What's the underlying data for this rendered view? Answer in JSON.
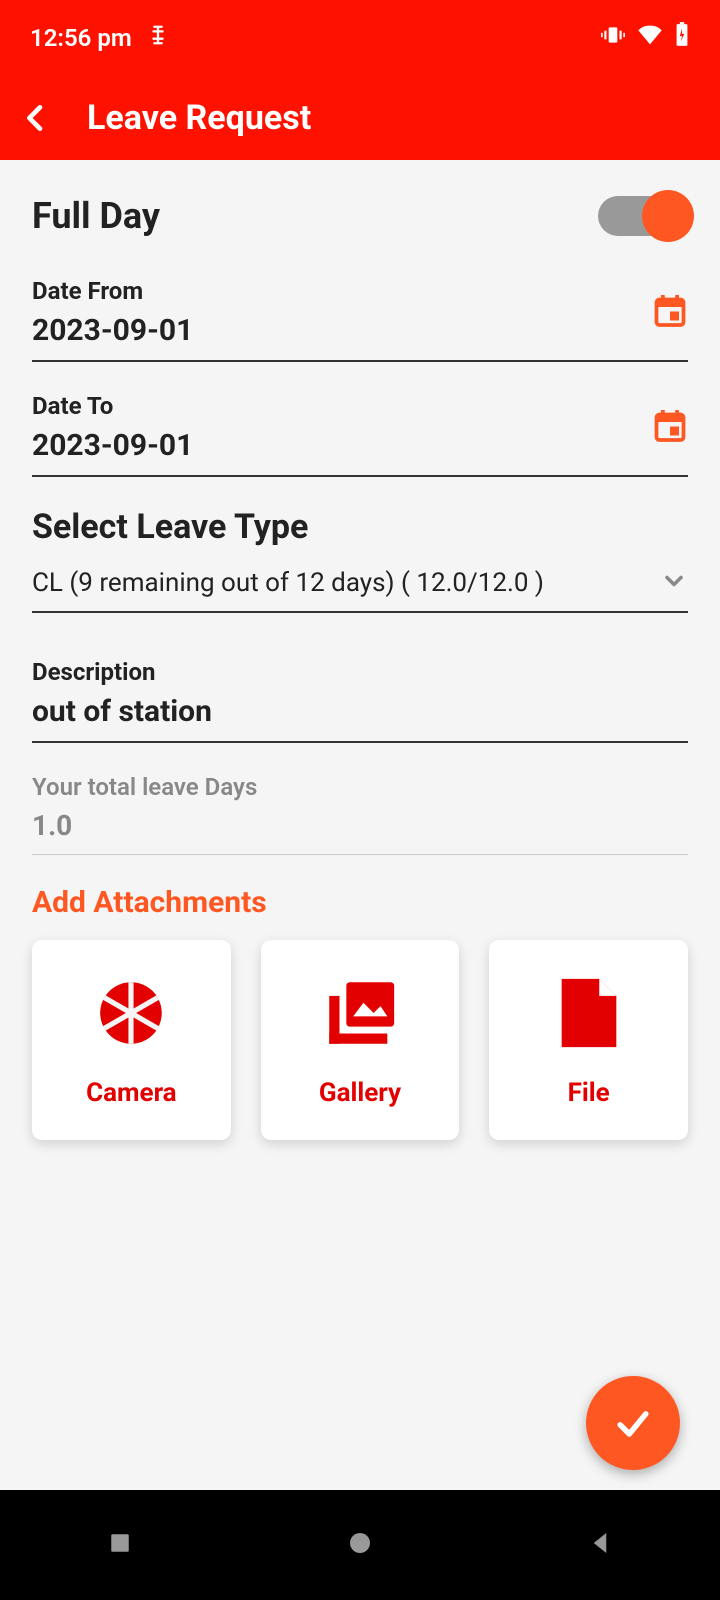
{
  "statusBar": {
    "time": "12:56 pm"
  },
  "appBar": {
    "title": "Leave Request"
  },
  "fullDay": {
    "label": "Full Day",
    "enabled": true
  },
  "dateFrom": {
    "label": "Date From",
    "value": "2023-09-01"
  },
  "dateTo": {
    "label": "Date To",
    "value": "2023-09-01"
  },
  "leaveType": {
    "sectionTitle": "Select Leave Type",
    "selected": "CL (9 remaining out of 12 days) ( 12.0/12.0 )"
  },
  "description": {
    "label": "Description",
    "value": "out of station"
  },
  "totalDays": {
    "label": "Your total leave Days",
    "value": "1.0"
  },
  "attachments": {
    "title": "Add Attachments",
    "options": {
      "camera": "Camera",
      "gallery": "Gallery",
      "file": "File"
    }
  }
}
